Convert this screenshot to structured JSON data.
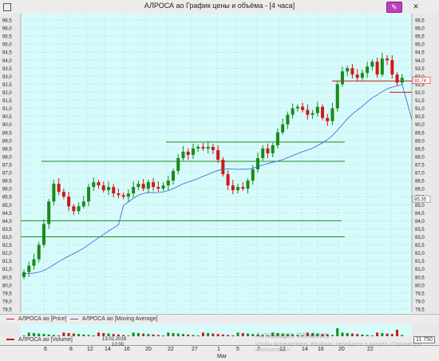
{
  "window": {
    "title": "АЛРОСА ао График цены и объёма - [4 часа]",
    "pin_label": "✎",
    "close_label": "✕"
  },
  "legend": {
    "price": "АЛРОСА ао [Price]",
    "ma": "АЛРОСА ао [Moving Average]",
    "volume": "АЛРОСА ао [Volume]",
    "volume_value": "11 750"
  },
  "price_axis": {
    "labels": [
      "96,5",
      "96,0",
      "95,5",
      "95,0",
      "94,5",
      "94,0",
      "93,5",
      "93,0",
      "92,5",
      "92,0",
      "91,5",
      "91,0",
      "90,5",
      "90,0",
      "89,5",
      "89,0",
      "88,5",
      "88,0",
      "87,5",
      "87,0",
      "86,5",
      "86,0",
      "85,5",
      "85,0",
      "84,5",
      "84,0",
      "83,5",
      "83,0",
      "82,5",
      "82,0",
      "81,5",
      "81,0",
      "80,5",
      "80,0",
      "79,5",
      "79,0",
      "78,5"
    ],
    "current_price": "92,74",
    "marker_85": "85,35"
  },
  "x_axis": {
    "ticks": [
      "6",
      "8",
      "12",
      "14",
      "16",
      "20",
      "22",
      "27",
      "1",
      "5",
      "7",
      "12",
      "14",
      "16",
      "20",
      "22"
    ],
    "cursor_date": "13.02.2018",
    "cursor_time": "12:00",
    "month_label": "Mar"
  },
  "watermark": {
    "line1": "Активация Windows",
    "line2": "Чтобы активировать Windows, перейдите в раздел «Параметры компьютера»."
  },
  "colors": {
    "background": "#d6fbfa",
    "up_candle": "#1a8a1a",
    "down_candle": "#d01818",
    "level_line": "#1c8a1c",
    "ma_line": "#3a5fd8"
  },
  "chart_data": {
    "type": "candlestick",
    "ylim": [
      78.5,
      96.5
    ],
    "levels": [
      88.9,
      87.7,
      84.0,
      83.0,
      92.7,
      92.0
    ],
    "close_series": [
      80.8,
      81.2,
      81.6,
      82.5,
      83.8,
      85.2,
      86.3,
      85.8,
      85.5,
      84.9,
      84.6,
      84.9,
      85.2,
      86.1,
      86.4,
      86.2,
      85.9,
      86.1,
      85.7,
      85.6,
      85.5,
      85.7,
      86.1,
      86.3,
      86.0,
      86.4,
      86.1,
      86.0,
      86.2,
      86.5,
      87.1,
      87.9,
      88.3,
      88.1,
      88.5,
      88.6,
      88.5,
      88.6,
      88.4,
      87.8,
      86.9,
      86.2,
      85.9,
      86.1,
      86.0,
      86.5,
      87.2,
      87.9,
      88.5,
      88.2,
      88.7,
      89.5,
      90.0,
      90.6,
      91.0,
      91.1,
      90.9,
      90.6,
      90.7,
      91.1,
      90.4,
      90.2,
      91.0,
      92.5,
      93.3,
      93.5,
      93.1,
      92.9,
      93.2,
      93.6,
      93.9,
      93.1,
      94.1,
      94.0,
      93.1,
      92.6,
      92.9
    ]
  }
}
